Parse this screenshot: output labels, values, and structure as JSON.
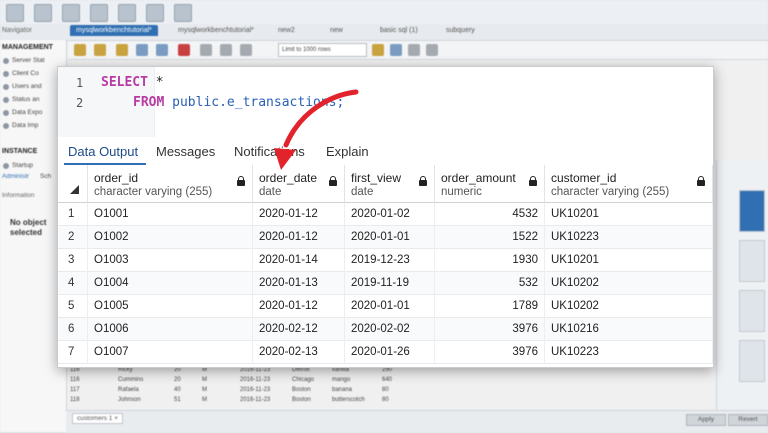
{
  "background": {
    "tabs": [
      "mysqlworkbenchtutorial*",
      "mysqlworkbenchtutorial*",
      "new2",
      "new",
      "basic sql (1)",
      "subquery"
    ],
    "navigator_label": "Navigator",
    "limit_select": "Limit to 1000 rows",
    "sidebar": {
      "management_heading": "MANAGEMENT",
      "management_items": [
        "Server Stat",
        "Client Co",
        "Users and",
        "Status an",
        "Data Expo",
        "Data Imp"
      ],
      "instance_heading": "INSTANCE",
      "instance_items": [
        "Startup"
      ],
      "bottom_tabs": [
        "Administr",
        "Sch"
      ],
      "information_label": "Information",
      "no_object_text": "No object selected"
    },
    "result_rows": [
      [
        "116",
        "Ricky",
        "20",
        "M",
        "2016-11-23",
        "Detroit",
        "vanilla",
        "290"
      ],
      [
        "116",
        "Cummins",
        "20",
        "M",
        "2016-11-23",
        "Chicago",
        "mango",
        "640"
      ],
      [
        "117",
        "Rafaela",
        "40",
        "M",
        "2016-11-23",
        "Boston",
        "banana",
        "80"
      ],
      [
        "118",
        "Johnson",
        "51",
        "M",
        "2016-11-23",
        "Boston",
        "butterscotch",
        "80"
      ]
    ],
    "bottom_tab": "customers 1 ×",
    "buttons": [
      "Apply",
      "Revert"
    ]
  },
  "editor": {
    "line_numbers": [
      "1",
      "2"
    ],
    "line1_keyword": "SELECT",
    "line1_rest": " *",
    "line2_keyword": "FROM",
    "line2_rest": " public.e_transactions;"
  },
  "tabs": [
    "Data Output",
    "Messages",
    "Notifications",
    "Explain"
  ],
  "table": {
    "columns": [
      {
        "name": "order_id",
        "type": "character varying (255)"
      },
      {
        "name": "order_date",
        "type": "date"
      },
      {
        "name": "first_view",
        "type": "date"
      },
      {
        "name": "order_amount",
        "type": "numeric"
      },
      {
        "name": "customer_id",
        "type": "character varying (255)"
      }
    ],
    "rows": [
      [
        "1",
        "O1001",
        "2020-01-12",
        "2020-01-02",
        "4532",
        "UK10201"
      ],
      [
        "2",
        "O1002",
        "2020-01-12",
        "2020-01-01",
        "1522",
        "UK10223"
      ],
      [
        "3",
        "O1003",
        "2020-01-14",
        "2019-12-23",
        "1930",
        "UK10201"
      ],
      [
        "4",
        "O1004",
        "2020-01-13",
        "2019-11-19",
        "532",
        "UK10202"
      ],
      [
        "5",
        "O1005",
        "2020-01-12",
        "2020-01-01",
        "1789",
        "UK10202"
      ],
      [
        "6",
        "O1006",
        "2020-02-12",
        "2020-02-02",
        "3976",
        "UK10216"
      ],
      [
        "7",
        "O1007",
        "2020-02-13",
        "2020-01-26",
        "3976",
        "UK10223"
      ]
    ]
  },
  "colors": {
    "accent": "#2f6fb2",
    "arrow": "#e3232c",
    "keyword": "#b83aa3",
    "identifier": "#2a5fb7"
  }
}
